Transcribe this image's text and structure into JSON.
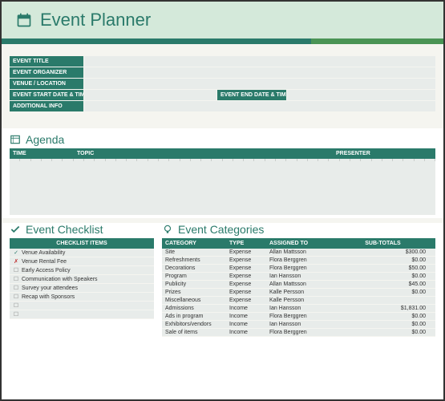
{
  "header": {
    "title": "Event Planner"
  },
  "details": {
    "title_label": "EVENT TITLE",
    "organizer_label": "EVENT ORGANIZER",
    "venue_label": "VENUE / LOCATION",
    "start_label": "EVENT START DATE & TIME",
    "end_label": "EVENT END DATE & TIME",
    "additional_label": "ADDITIONAL INFO"
  },
  "agenda": {
    "heading": "Agenda",
    "cols": {
      "time": "TIME",
      "topic": "TOPIC",
      "presenter": "PRESENTER"
    }
  },
  "checklist": {
    "heading": "Event Checklist",
    "col": "CHECKLIST ITEMS",
    "items": [
      {
        "status": "done",
        "text": "Venue Availability"
      },
      {
        "status": "fail",
        "text": "Venue Rental Fee"
      },
      {
        "status": "box",
        "text": "Early Access Policy"
      },
      {
        "status": "box",
        "text": "Communication with Speakers"
      },
      {
        "status": "box",
        "text": "Survey your attendees"
      },
      {
        "status": "box",
        "text": "Recap with Sponsors"
      },
      {
        "status": "box",
        "text": ""
      },
      {
        "status": "box",
        "text": ""
      }
    ]
  },
  "categories": {
    "heading": "Event Categories",
    "cols": {
      "category": "CATEGORY",
      "type": "TYPE",
      "assigned": "ASSIGNED TO",
      "sub": "SUB-TOTALS"
    },
    "rows": [
      {
        "category": "Site",
        "type": "Expense",
        "assigned": "Allan Mattsson",
        "sub": "$300.00"
      },
      {
        "category": "Refreshments",
        "type": "Expense",
        "assigned": "Flora Berggren",
        "sub": "$0.00"
      },
      {
        "category": "Decorations",
        "type": "Expense",
        "assigned": "Flora Berggren",
        "sub": "$50.00"
      },
      {
        "category": "Program",
        "type": "Expense",
        "assigned": "Ian Hansson",
        "sub": "$0.00"
      },
      {
        "category": "Publicity",
        "type": "Expense",
        "assigned": "Allan Mattsson",
        "sub": "$45.00"
      },
      {
        "category": "Prizes",
        "type": "Expense",
        "assigned": "Kalle Persson",
        "sub": "$0.00"
      },
      {
        "category": "Miscellaneous",
        "type": "Expense",
        "assigned": "Kalle Persson",
        "sub": ""
      },
      {
        "category": "Admissions",
        "type": "Income",
        "assigned": "Ian Hansson",
        "sub": "$1,831.00"
      },
      {
        "category": "Ads in program",
        "type": "Income",
        "assigned": "Flora Berggren",
        "sub": "$0.00"
      },
      {
        "category": "Exhibitors/vendors",
        "type": "Income",
        "assigned": "Ian Hansson",
        "sub": "$0.00"
      },
      {
        "category": "Sale of items",
        "type": "Income",
        "assigned": "Flora Berggren",
        "sub": "$0.00"
      }
    ]
  }
}
